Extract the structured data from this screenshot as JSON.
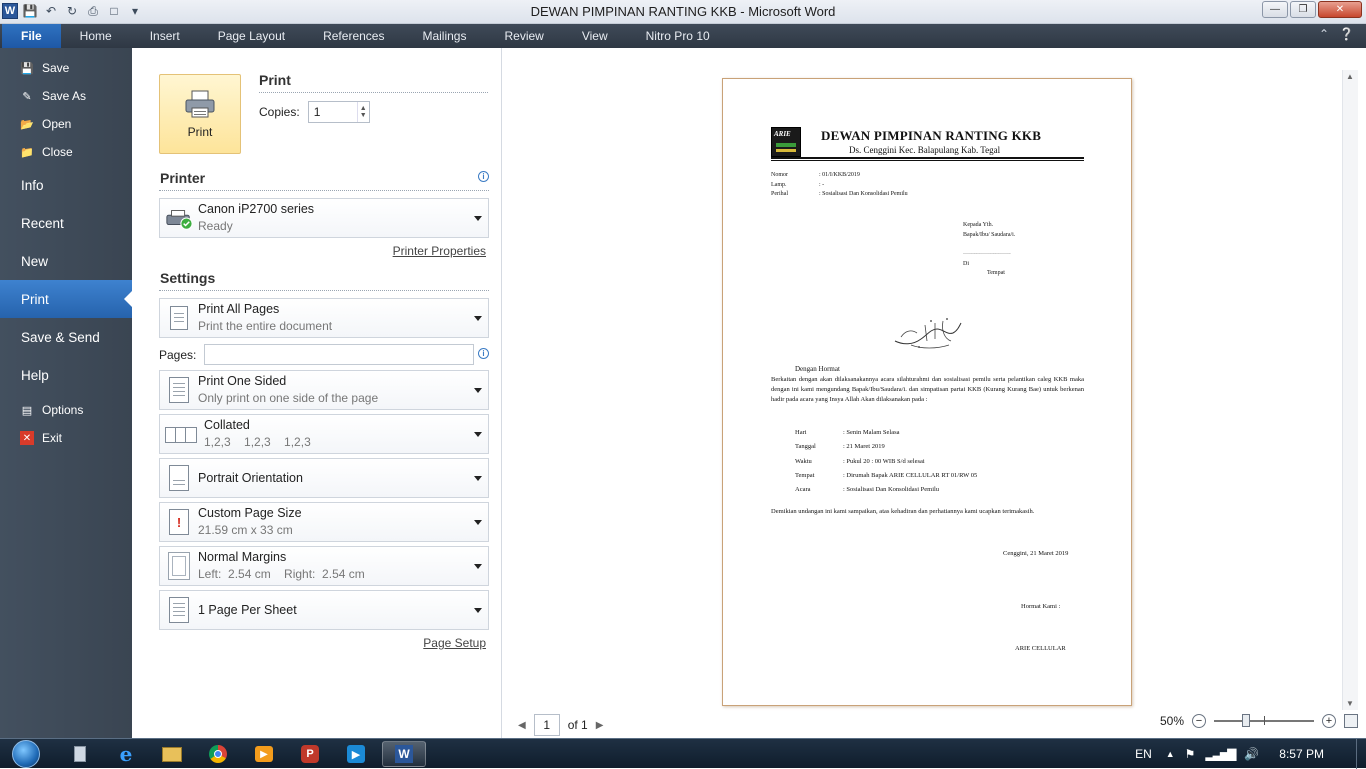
{
  "window": {
    "title": "DEWAN PIMPINAN RANTING KKB  -  Microsoft Word"
  },
  "ribbon": {
    "tabs": [
      "File",
      "Home",
      "Insert",
      "Page Layout",
      "References",
      "Mailings",
      "Review",
      "View",
      "Nitro Pro 10"
    ]
  },
  "backstage": {
    "small_items": [
      {
        "label": "Save",
        "icon": "save-icon"
      },
      {
        "label": "Save As",
        "icon": "save-as-icon"
      },
      {
        "label": "Open",
        "icon": "open-folder-icon"
      },
      {
        "label": "Close",
        "icon": "close-folder-icon"
      }
    ],
    "big_items": [
      "Info",
      "Recent",
      "New",
      "Print",
      "Save & Send",
      "Help"
    ],
    "active": "Print",
    "bottom_items": [
      {
        "label": "Options",
        "icon": "options-icon"
      },
      {
        "label": "Exit",
        "icon": "exit-icon"
      }
    ]
  },
  "print": {
    "section_title": "Print",
    "button_label": "Print",
    "copies_label": "Copies:",
    "copies_value": "1",
    "printer_title": "Printer",
    "printer_name": "Canon iP2700 series",
    "printer_status": "Ready",
    "printer_properties": "Printer Properties",
    "settings_title": "Settings",
    "pages_label": "Pages:",
    "pages_value": "",
    "page_setup": "Page Setup",
    "options": [
      {
        "t1": "Print All Pages",
        "t2": "Print the entire document"
      },
      {
        "t1": "Print One Sided",
        "t2": "Only print on one side of the page"
      },
      {
        "t1": "Collated",
        "t2": "1,2,3    1,2,3    1,2,3"
      },
      {
        "t1": "Portrait Orientation",
        "t2": ""
      },
      {
        "t1": "Custom Page Size",
        "t2": "21.59 cm x 33 cm"
      },
      {
        "t1": "Normal Margins",
        "t2": "Left:  2.54 cm    Right:  2.54 cm"
      },
      {
        "t1": "1 Page Per Sheet",
        "t2": ""
      }
    ]
  },
  "document": {
    "logo_text": "ARIE",
    "heading": "DEWAN  PIMPINAN RANTING KKB",
    "address": "Ds. Cenggini Kec. Balapulang Kab. Tegal",
    "meta": [
      {
        "k": "Nomor",
        "v": ": 01/I/KKB/2019"
      },
      {
        "k": "Lamp.",
        "v": ": -"
      },
      {
        "k": "Perihal",
        "v": ": Sosialisasi Dan Konsolidasi Pemilu"
      }
    ],
    "recipient": [
      "Kepada Yth.",
      "Bapak/Ibu/ Saudara/i.",
      "..................................................",
      "Di",
      "Tempat"
    ],
    "greeting": "Dengan Hormat",
    "body": "Berkaitan dengan akan dilaksanakannya acara silahturahmi dan sosialisasi pemilu serta pelantikan caleg KKB maka dengan ini kami mengundang Bapak/Ibu/Saudara/i. dan simpatisan partai KKB (Kurang Kurang Bae) untuk berkenan hadir pada acara yang Insya Allah Akan dilaksanakan pada :",
    "details": [
      {
        "k": "Hari",
        "v": ": Senin Malam Selasa"
      },
      {
        "k": "Tanggal",
        "v": ": 21 Maret 2019"
      },
      {
        "k": "Waktu",
        "v": ": Pukul 20 : 00 WIB S/d selesai"
      },
      {
        "k": "Tempat",
        "v": ": Dirumah Bapak ARIE CELLULAR RT 01/RW 05"
      },
      {
        "k": "Acara",
        "v": ": Sosialisasi Dan Konsolidasi Pemilu"
      }
    ],
    "closing": "Demikian undangan ini kami sampaikan, atas kehadiran dan perhatiannya kami ucapkan terimakasih.",
    "date": "Cenggini, 21 Maret 2019",
    "signoff": "Hormat Kami :",
    "signer": "ARIE CELLULAR"
  },
  "preview": {
    "page_value": "1",
    "page_of": "of 1",
    "zoom": "50%"
  },
  "taskbar": {
    "lang": "EN",
    "time": "8:57 PM"
  }
}
